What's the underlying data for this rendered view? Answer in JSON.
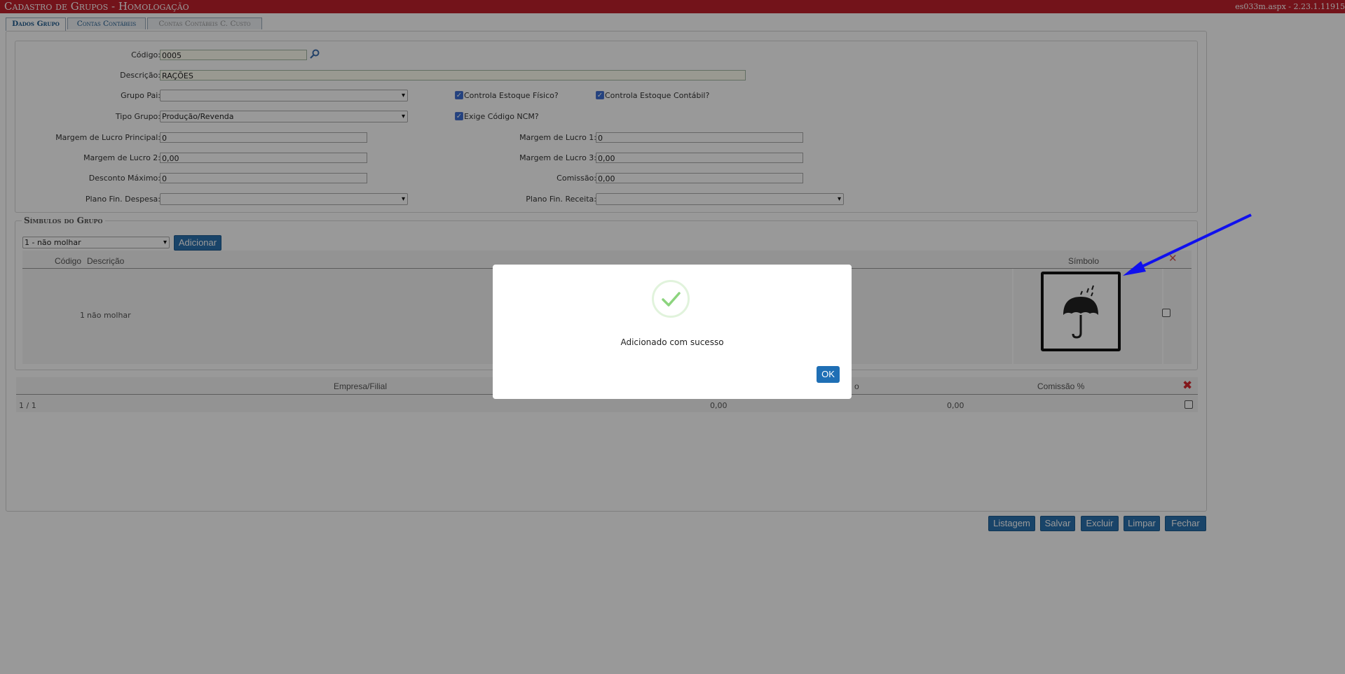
{
  "titlebar": {
    "title": "Cadastro de Grupos  - Homologação",
    "version": "es033m.aspx - 2.23.1.11915"
  },
  "tabs": [
    {
      "label": "Dados Grupo",
      "state": "active"
    },
    {
      "label": "Contas Contábeis",
      "state": "normal"
    },
    {
      "label": "Contas Contábeis C. Custo",
      "state": "disabled"
    }
  ],
  "form": {
    "codigo_label": "Código:",
    "codigo_value": "0005",
    "descricao_label": "Descrição:",
    "descricao_value": "RAÇÕES",
    "grupo_pai_label": "Grupo Pai:",
    "grupo_pai_value": "",
    "controla_estoque_fisico_label": "Controla Estoque Físico?",
    "controla_estoque_contabil_label": "Controla Estoque Contábil?",
    "tipo_grupo_label": "Tipo Grupo:",
    "tipo_grupo_value": "Produção/Revenda",
    "exige_ncm_label": "Exige Código NCM?",
    "margem_principal_label": "Margem de Lucro Principal:",
    "margem_principal_value": "0",
    "margem1_label": "Margem de Lucro 1:",
    "margem1_value": "0",
    "margem2_label": "Margem de Lucro 2:",
    "margem2_value": "0,00",
    "margem3_label": "Margem de Lucro 3:",
    "margem3_value": "0,00",
    "desconto_label": "Desconto Máximo:",
    "desconto_value": "0",
    "comissao_label": "Comissão:",
    "comissao_value": "0,00",
    "plano_despesa_label": "Plano Fin. Despesa:",
    "plano_despesa_value": "",
    "plano_receita_label": "Plano Fin. Receita:",
    "plano_receita_value": ""
  },
  "simbolos": {
    "legend": "Símbulos do Grupo",
    "select_value": "1 - não molhar",
    "add_button": "Adicionar",
    "headers": {
      "codigo": "Código",
      "descricao": "Descrição",
      "simbolo": "Símbolo"
    },
    "rows": [
      {
        "codigo": "1",
        "descricao": "não molhar",
        "icon": "umbrella-rain-icon"
      }
    ]
  },
  "comissoes": {
    "headers": {
      "empresa": "Empresa/Filial",
      "margem": "o",
      "comissao": "Comissão %"
    },
    "rows": [
      {
        "empresa": "1 / 1",
        "margem": "0,00",
        "comissao": "0,00"
      }
    ]
  },
  "footer_buttons": [
    "Listagem",
    "Salvar",
    "Excluir",
    "Limpar",
    "Fechar"
  ],
  "modal": {
    "message": "Adicionado com sucesso",
    "ok": "OK"
  },
  "colors": {
    "titlebar": "#c0202c",
    "button": "#2b72b0",
    "arrow": "#1010ee",
    "success": "#8cd47e"
  }
}
